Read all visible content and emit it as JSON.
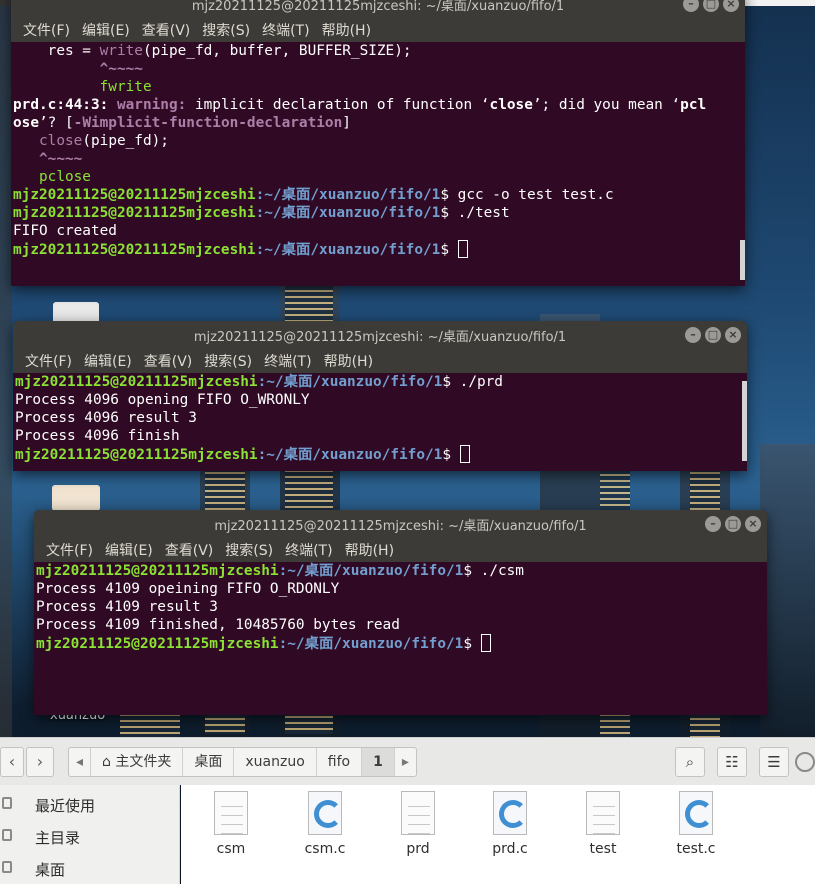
{
  "terminal1": {
    "title": "mjz20211125@20211125mjzceshi: ~/桌面/xuanzuo/fifo/1",
    "menu": [
      "文件(F)",
      "编辑(E)",
      "查看(V)",
      "搜索(S)",
      "终端(T)",
      "帮助(H)"
    ],
    "lines": {
      "l1_pre": "    res = ",
      "l1_fn": "write",
      "l1_post": "(pipe_fd, buffer, BUFFER_SIZE);",
      "l2": "          ^~~~~",
      "l3": "          fwrite",
      "l4_loc": "prd.c:44:3:",
      "l4_warn": " warning:",
      "l4_msg1": " implicit declaration of function ‘",
      "l4_b1": "close",
      "l4_msg2": "’; did you mean ‘",
      "l4_b2": "pcl",
      "l5_b": "ose",
      "l5_msg": "’? [",
      "l5_flag": "-Wimplicit-function-declaration",
      "l5_end": "]",
      "l6_pre": "   ",
      "l6_fn": "close",
      "l6_post": "(pipe_fd);",
      "l7": "   ^~~~~",
      "l8": "   pclose",
      "prompt_user": "mjz20211125@20211125mjzceshi",
      "prompt_path": ":~/桌面/xuanzuo/fifo/1",
      "prompt_end": "$ ",
      "cmd1": "gcc -o test test.c",
      "cmd2": "./test",
      "out1": "FIFO created"
    }
  },
  "terminal2": {
    "title": "mjz20211125@20211125mjzceshi: ~/桌面/xuanzuo/fifo/1",
    "menu": [
      "文件(F)",
      "编辑(E)",
      "查看(V)",
      "搜索(S)",
      "终端(T)",
      "帮助(H)"
    ],
    "cmd": "./prd",
    "out": [
      "Process 4096 opening FIFO O_WRONLY",
      "Process 4096 result 3",
      "Process 4096 finish"
    ]
  },
  "terminal3": {
    "title": "mjz20211125@20211125mjzceshi: ~/桌面/xuanzuo/fifo/1",
    "menu": [
      "文件(F)",
      "编辑(E)",
      "查看(V)",
      "搜索(S)",
      "终端(T)",
      "帮助(H)"
    ],
    "cmd": "./csm",
    "out": [
      "Process 4109 opeining FIFO O_RDONLY",
      "Process 4109 result 3",
      "Process 4109 finished, 10485760 bytes read"
    ]
  },
  "desktop": {
    "label": "xuanzuo"
  },
  "file_manager": {
    "crumbs": [
      "主文件夹",
      "桌面",
      "xuanzuo",
      "fifo",
      "1"
    ],
    "sidebar": [
      "最近使用",
      "主目录",
      "桌面"
    ],
    "files": [
      {
        "name": "csm",
        "kind": "binary"
      },
      {
        "name": "csm.c",
        "kind": "c-source"
      },
      {
        "name": "prd",
        "kind": "binary"
      },
      {
        "name": "prd.c",
        "kind": "c-source"
      },
      {
        "name": "test",
        "kind": "binary"
      },
      {
        "name": "test.c",
        "kind": "c-source"
      }
    ]
  },
  "colors": {
    "terminal_bg": "#300a24",
    "prompt_user": "#8ae234",
    "prompt_path": "#729fcf",
    "titlebar": "#3c3b37"
  }
}
